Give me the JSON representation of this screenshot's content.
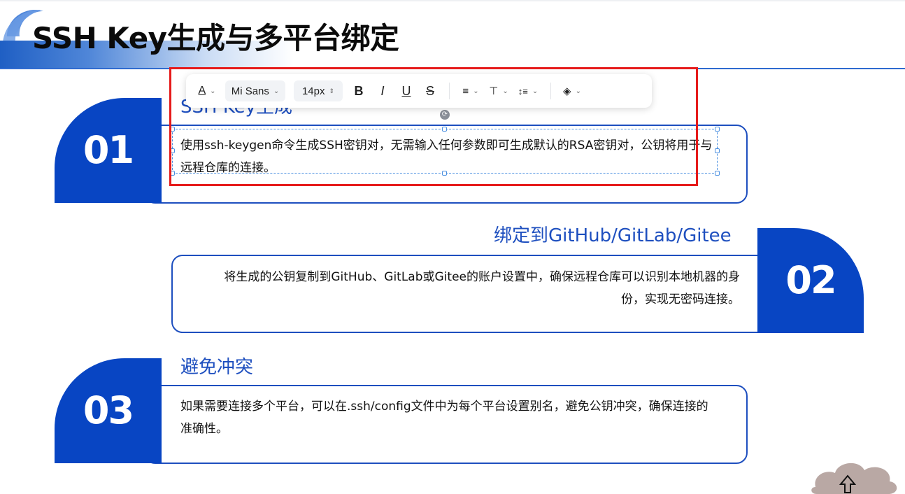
{
  "slide": {
    "title": "SSH Key生成与多平台绑定",
    "items": [
      {
        "number": "01",
        "heading": "SSH Key生成",
        "body": "使用ssh-keygen命令生成SSH密钥对，无需输入任何参数即可生成默认的RSA密钥对，公钥将用于与远程仓库的连接。"
      },
      {
        "number": "02",
        "heading": "绑定到GitHub/GitLab/Gitee",
        "body": "将生成的公钥复制到GitHub、GitLab或Gitee的账户设置中，确保远程仓库可以识别本地机器的身份，实现无密码连接。"
      },
      {
        "number": "03",
        "heading": "避免冲突",
        "body": "如果需要连接多个平台，可以在.ssh/config文件中为每个平台设置别名，避免公钥冲突，确保连接的准确性。"
      }
    ]
  },
  "toolbar": {
    "font_family": "Mi Sans",
    "font_size": "14px",
    "icons": {
      "font_color": "font-color-icon",
      "bold": "B",
      "italic": "I",
      "underline": "U",
      "strikethrough": "S",
      "align": "≡",
      "vertical_align": "⊤",
      "line_spacing": "↕≡",
      "layer": "◈"
    }
  },
  "colors": {
    "accent": "#0845c3",
    "heading": "#1e4fbf",
    "highlight_box": "#e61b1b",
    "selection": "#4a8fe0"
  }
}
